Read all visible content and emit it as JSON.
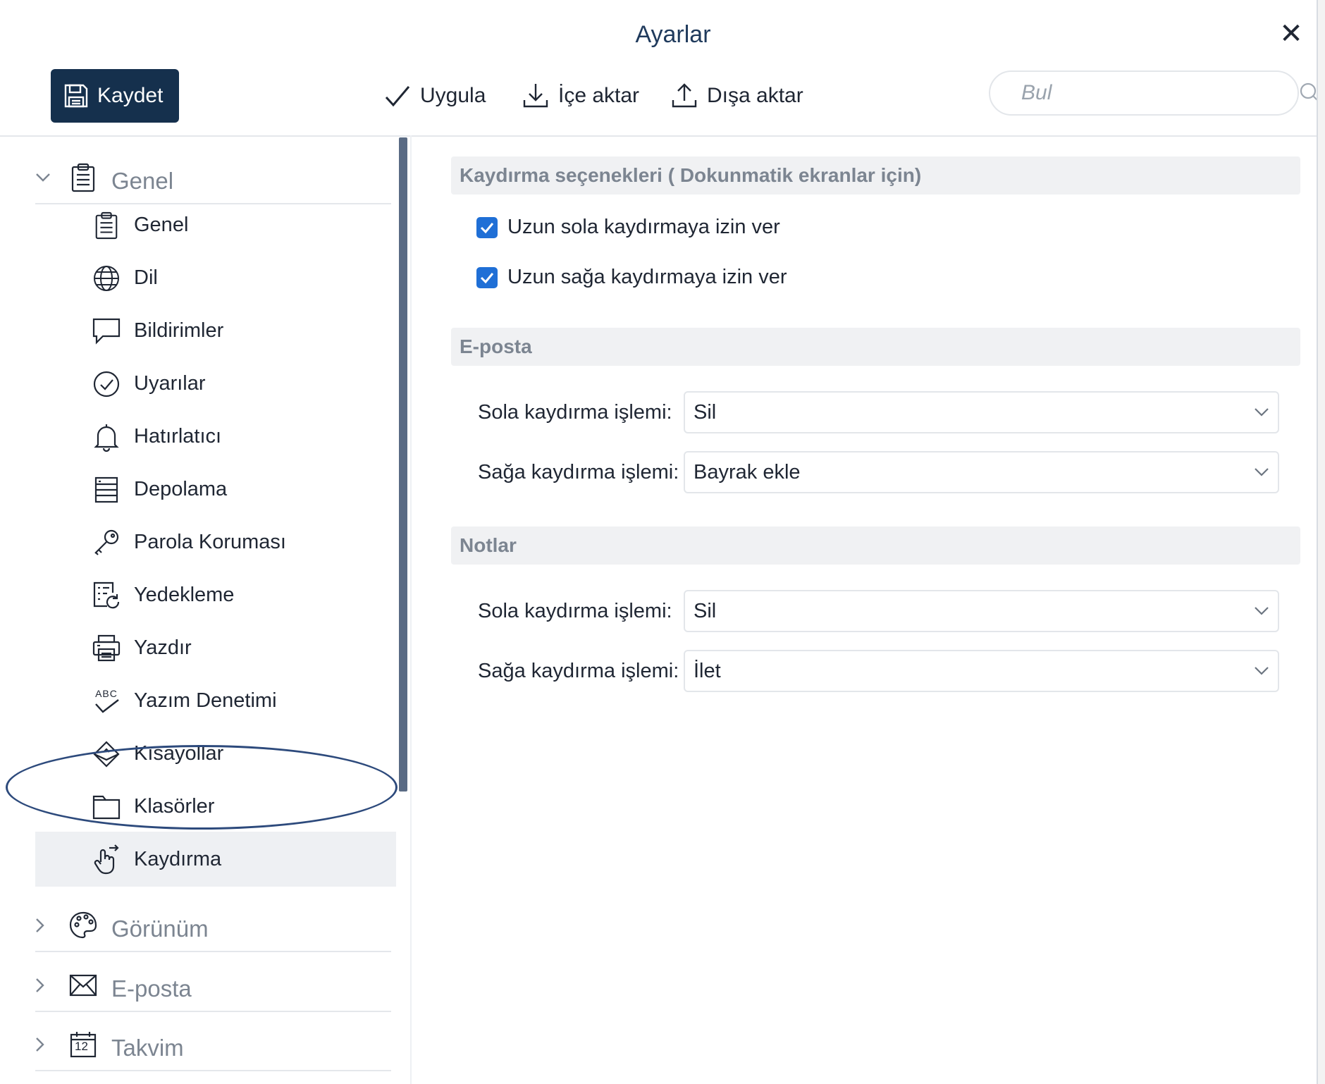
{
  "window": {
    "title": "Ayarlar"
  },
  "toolbar": {
    "save_label": "Kaydet",
    "apply_label": "Uygula",
    "import_label": "İçe aktar",
    "export_label": "Dışa aktar",
    "search_placeholder": "Bul"
  },
  "sidebar": {
    "groups": [
      {
        "label": "Genel",
        "icon": "clipboard-icon",
        "expanded": true
      },
      {
        "label": "Görünüm",
        "icon": "palette-icon",
        "expanded": false
      },
      {
        "label": "E-posta",
        "icon": "envelope-icon",
        "expanded": false
      },
      {
        "label": "Takvim",
        "icon": "calendar-icon",
        "expanded": false,
        "icon_text": "12"
      }
    ],
    "items": [
      {
        "label": "Genel",
        "icon": "clipboard-icon"
      },
      {
        "label": "Dil",
        "icon": "globe-icon"
      },
      {
        "label": "Bildirimler",
        "icon": "speech-bubble-icon"
      },
      {
        "label": "Uyarılar",
        "icon": "check-circle-icon"
      },
      {
        "label": "Hatırlatıcı",
        "icon": "bell-icon"
      },
      {
        "label": "Depolama",
        "icon": "storage-icon"
      },
      {
        "label": "Parola Koruması",
        "icon": "key-icon"
      },
      {
        "label": "Yedekleme",
        "icon": "backup-icon"
      },
      {
        "label": "Yazdır",
        "icon": "printer-icon"
      },
      {
        "label": "Yazım Denetimi",
        "icon": "spellcheck-icon",
        "icon_text": "ABC"
      },
      {
        "label": "Kısayollar",
        "icon": "shortcut-icon"
      },
      {
        "label": "Klasörler",
        "icon": "folder-icon"
      },
      {
        "label": "Kaydırma",
        "icon": "swipe-hand-icon",
        "active": true
      }
    ]
  },
  "content": {
    "swipe_section": {
      "title": "Kaydırma seçenekleri ( Dokunmatik ekranlar için)",
      "options": [
        {
          "label": "Uzun sola kaydırmaya izin ver",
          "checked": true
        },
        {
          "label": "Uzun sağa kaydırmaya izin ver",
          "checked": true
        }
      ]
    },
    "email_section": {
      "title": "E-posta",
      "left_label": "Sola kaydırma işlemi:",
      "left_value": "Sil",
      "right_label": "Sağa kaydırma işlemi:",
      "right_value": "Bayrak ekle"
    },
    "notes_section": {
      "title": "Notlar",
      "left_label": "Sola kaydırma işlemi:",
      "left_value": "Sil",
      "right_label": "Sağa kaydırma işlemi:",
      "right_value": "İlet"
    }
  },
  "colors": {
    "primary": "#15304d",
    "checkbox": "#1f6fd6",
    "section_bg": "#f0f1f3",
    "muted_text": "#7c8591",
    "highlight_ellipse": "#2d4a7c"
  }
}
